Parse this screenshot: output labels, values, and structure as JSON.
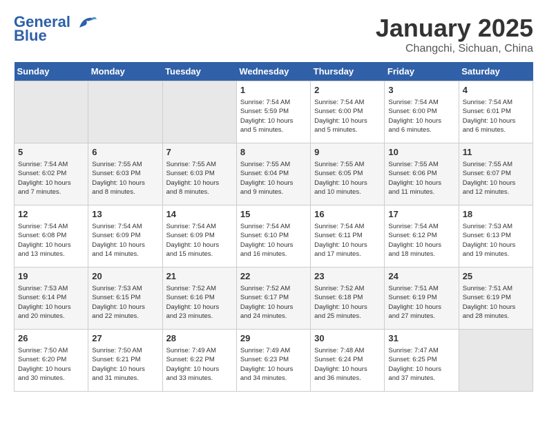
{
  "header": {
    "logo_line1": "General",
    "logo_line2": "Blue",
    "month_title": "January 2025",
    "location": "Changchi, Sichuan, China"
  },
  "weekdays": [
    "Sunday",
    "Monday",
    "Tuesday",
    "Wednesday",
    "Thursday",
    "Friday",
    "Saturday"
  ],
  "weeks": [
    [
      {
        "day": "",
        "info": ""
      },
      {
        "day": "",
        "info": ""
      },
      {
        "day": "",
        "info": ""
      },
      {
        "day": "1",
        "info": "Sunrise: 7:54 AM\nSunset: 5:59 PM\nDaylight: 10 hours\nand 5 minutes."
      },
      {
        "day": "2",
        "info": "Sunrise: 7:54 AM\nSunset: 6:00 PM\nDaylight: 10 hours\nand 5 minutes."
      },
      {
        "day": "3",
        "info": "Sunrise: 7:54 AM\nSunset: 6:00 PM\nDaylight: 10 hours\nand 6 minutes."
      },
      {
        "day": "4",
        "info": "Sunrise: 7:54 AM\nSunset: 6:01 PM\nDaylight: 10 hours\nand 6 minutes."
      }
    ],
    [
      {
        "day": "5",
        "info": "Sunrise: 7:54 AM\nSunset: 6:02 PM\nDaylight: 10 hours\nand 7 minutes."
      },
      {
        "day": "6",
        "info": "Sunrise: 7:55 AM\nSunset: 6:03 PM\nDaylight: 10 hours\nand 8 minutes."
      },
      {
        "day": "7",
        "info": "Sunrise: 7:55 AM\nSunset: 6:03 PM\nDaylight: 10 hours\nand 8 minutes."
      },
      {
        "day": "8",
        "info": "Sunrise: 7:55 AM\nSunset: 6:04 PM\nDaylight: 10 hours\nand 9 minutes."
      },
      {
        "day": "9",
        "info": "Sunrise: 7:55 AM\nSunset: 6:05 PM\nDaylight: 10 hours\nand 10 minutes."
      },
      {
        "day": "10",
        "info": "Sunrise: 7:55 AM\nSunset: 6:06 PM\nDaylight: 10 hours\nand 11 minutes."
      },
      {
        "day": "11",
        "info": "Sunrise: 7:55 AM\nSunset: 6:07 PM\nDaylight: 10 hours\nand 12 minutes."
      }
    ],
    [
      {
        "day": "12",
        "info": "Sunrise: 7:54 AM\nSunset: 6:08 PM\nDaylight: 10 hours\nand 13 minutes."
      },
      {
        "day": "13",
        "info": "Sunrise: 7:54 AM\nSunset: 6:09 PM\nDaylight: 10 hours\nand 14 minutes."
      },
      {
        "day": "14",
        "info": "Sunrise: 7:54 AM\nSunset: 6:09 PM\nDaylight: 10 hours\nand 15 minutes."
      },
      {
        "day": "15",
        "info": "Sunrise: 7:54 AM\nSunset: 6:10 PM\nDaylight: 10 hours\nand 16 minutes."
      },
      {
        "day": "16",
        "info": "Sunrise: 7:54 AM\nSunset: 6:11 PM\nDaylight: 10 hours\nand 17 minutes."
      },
      {
        "day": "17",
        "info": "Sunrise: 7:54 AM\nSunset: 6:12 PM\nDaylight: 10 hours\nand 18 minutes."
      },
      {
        "day": "18",
        "info": "Sunrise: 7:53 AM\nSunset: 6:13 PM\nDaylight: 10 hours\nand 19 minutes."
      }
    ],
    [
      {
        "day": "19",
        "info": "Sunrise: 7:53 AM\nSunset: 6:14 PM\nDaylight: 10 hours\nand 20 minutes."
      },
      {
        "day": "20",
        "info": "Sunrise: 7:53 AM\nSunset: 6:15 PM\nDaylight: 10 hours\nand 22 minutes."
      },
      {
        "day": "21",
        "info": "Sunrise: 7:52 AM\nSunset: 6:16 PM\nDaylight: 10 hours\nand 23 minutes."
      },
      {
        "day": "22",
        "info": "Sunrise: 7:52 AM\nSunset: 6:17 PM\nDaylight: 10 hours\nand 24 minutes."
      },
      {
        "day": "23",
        "info": "Sunrise: 7:52 AM\nSunset: 6:18 PM\nDaylight: 10 hours\nand 25 minutes."
      },
      {
        "day": "24",
        "info": "Sunrise: 7:51 AM\nSunset: 6:19 PM\nDaylight: 10 hours\nand 27 minutes."
      },
      {
        "day": "25",
        "info": "Sunrise: 7:51 AM\nSunset: 6:19 PM\nDaylight: 10 hours\nand 28 minutes."
      }
    ],
    [
      {
        "day": "26",
        "info": "Sunrise: 7:50 AM\nSunset: 6:20 PM\nDaylight: 10 hours\nand 30 minutes."
      },
      {
        "day": "27",
        "info": "Sunrise: 7:50 AM\nSunset: 6:21 PM\nDaylight: 10 hours\nand 31 minutes."
      },
      {
        "day": "28",
        "info": "Sunrise: 7:49 AM\nSunset: 6:22 PM\nDaylight: 10 hours\nand 33 minutes."
      },
      {
        "day": "29",
        "info": "Sunrise: 7:49 AM\nSunset: 6:23 PM\nDaylight: 10 hours\nand 34 minutes."
      },
      {
        "day": "30",
        "info": "Sunrise: 7:48 AM\nSunset: 6:24 PM\nDaylight: 10 hours\nand 36 minutes."
      },
      {
        "day": "31",
        "info": "Sunrise: 7:47 AM\nSunset: 6:25 PM\nDaylight: 10 hours\nand 37 minutes."
      },
      {
        "day": "",
        "info": ""
      }
    ]
  ]
}
